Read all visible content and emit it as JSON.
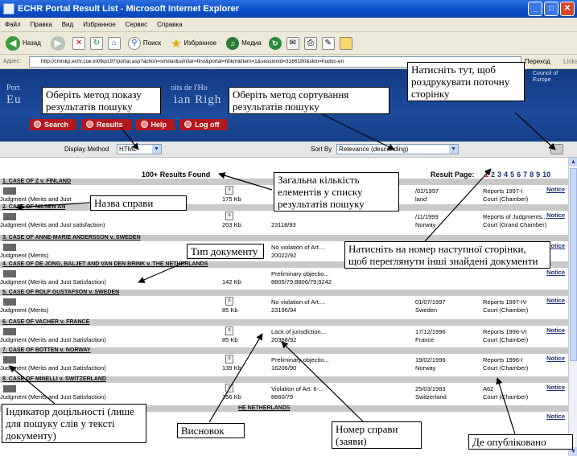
{
  "window": {
    "title": "ECHR Portal Result List - Microsoft Internet Explorer",
    "buttons": [
      "_",
      "□",
      "✕"
    ]
  },
  "menu": [
    "Файл",
    "Правка",
    "Вид",
    "Избранное",
    "Сервис",
    "Справка"
  ],
  "toolbar": {
    "back": "Назад",
    "search": "Поиск",
    "favorites": "Избранное",
    "media": "Медиа"
  },
  "address": {
    "label": "Адрес:",
    "url": "http://cmiskp.echr.coe.int/tkp197/portal.asp?action=similar&similar=first&portal=hbkm&Item=1&sessionid=3166180&skin=hudoc-en",
    "go": "Переход",
    "links": "Links"
  },
  "portal": {
    "line1_left": "Port",
    "line2_left": "Eu",
    "line1_right": "oits de l'Ho",
    "line2_right": "ian Righ",
    "coe": "Council of Europe",
    "tabs": [
      "Search",
      "Results",
      "Help",
      "Log off"
    ]
  },
  "options": {
    "display_label": "Display Method",
    "display_value": "HTML",
    "sort_label": "Sort By",
    "sort_value": "Relevance (descending)"
  },
  "results": {
    "found": "100+ Results Found",
    "page_label": "Result Page:",
    "pages": [
      "1",
      "2",
      "3",
      "4",
      "5",
      "6",
      "7",
      "8",
      "9",
      "10"
    ],
    "notice_label": "Notice",
    "cases": [
      {
        "title": "1. CASE OF Z v. FINLAND",
        "type": "Judgment (Merits and Just",
        "size": "175 Kb",
        "conclusion": "",
        "app": "",
        "date": "/02/1997",
        "country": "land",
        "report": "Reports 1997-I",
        "court": "Court (Chamber)"
      },
      {
        "title": "2. CASE OF NILSEN AN",
        "type": "Judgment (Merits and Just satisfaction)",
        "size": "203 Kb",
        "conclusion": "",
        "app": "23118/93",
        "date": "/11/1999",
        "country": "Norway",
        "report": "Reports of Judgments...",
        "court": "Court (Grand Chamber)"
      },
      {
        "title": "3. CASE OF ANNE-MARIE ANDERSSON v. SWEDEN",
        "type": "Judgment (Merits)",
        "size": "",
        "conclusion": "No violation of Art....",
        "app": "20022/92",
        "date": "",
        "country": "",
        "report": "",
        "court": ""
      },
      {
        "title": "4. CASE OF DE JONG, BALJET AND VAN DEN BRINK v. THE NETHERLANDS",
        "type": "Judgment (Merits and Just Satisfaction)",
        "size": "142 Kb",
        "conclusion": "Preliminary objectio...",
        "app": "8805/79;8806/79;9242",
        "date": "",
        "country": "",
        "report": "",
        "court": ""
      },
      {
        "title": "5. CASE OF ROLF GUSTAFSON v. SWEDEN",
        "type": "Judgment (Merits)",
        "size": "85 Kb",
        "conclusion": "No violation of Art....",
        "app": "23196/94",
        "date": "01/07/1997",
        "country": "Sweden",
        "report": "Reports 1997-IV",
        "court": "Court (Chamber)"
      },
      {
        "title": "6. CASE OF VACHER v. FRANCE",
        "type": "Judgment (Merits and Just Satisfaction)",
        "size": "85 Kb",
        "conclusion": "Lack of jurisdiction...",
        "app": "20368/92",
        "date": "17/12/1996",
        "country": "France",
        "report": "Reports 1996-VI",
        "court": "Court (Chamber)"
      },
      {
        "title": "7. CASE OF BOTTEN v. NORWAY",
        "type": "Judgment (Merits and Just Satisfaction)",
        "size": "139 Kb",
        "conclusion": "Preliminary objectio...",
        "app": "16206/90",
        "date": "19/02/1996",
        "country": "Norway",
        "report": "Reports 1996-I",
        "court": "Court (Chamber)"
      },
      {
        "title": "8. CASE OF MINELLI v. SWITZERLAND",
        "type": "Judgment (Merits and Just Satisfaction)",
        "size": "156 Kb",
        "conclusion": "Violation of Art. 6-...",
        "app": "8660/79",
        "date": "25/03/1983",
        "country": "Switzerland",
        "report": "A62",
        "court": "Court (Chamber)"
      },
      {
        "title": "HE NETHERLANDS",
        "type": "",
        "size": "",
        "conclusion": "",
        "app": "",
        "date": "",
        "country": "",
        "report": "",
        "court": ""
      }
    ]
  },
  "annotations": {
    "display_method": "Оберіть метод показу результатів пошуку",
    "sort_method": "Оберіть метод сортування результатів пошуку",
    "print": "Натисніть тут, щоб роздрукувати поточну сторінку",
    "total": "Загальна кількість елементів у списку результатів пошуку",
    "case_name": "Назва справи",
    "doc_type": "Тип документу",
    "next_page": "Натисніть на номер наступної сторінки, щоб переглянути інші знайдені документи",
    "relevance": "Індикатор доцільності (лише для пошуку слів у тексті документу)",
    "conclusion": "Висновок",
    "app_number": "Номер справи (заяви)",
    "published": "Де опубліковано"
  }
}
